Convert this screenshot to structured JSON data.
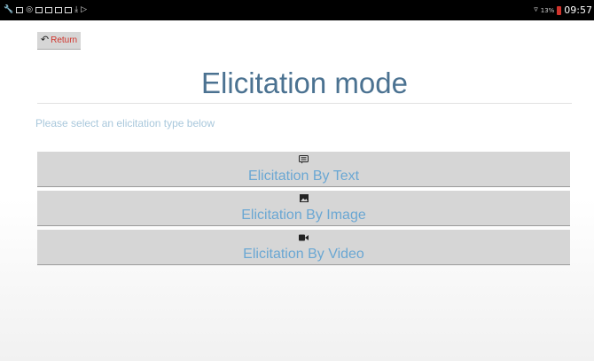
{
  "status_bar": {
    "battery_percent": "13%",
    "time": "09:57"
  },
  "return_button": {
    "label": "Return"
  },
  "page": {
    "title": "Elicitation mode",
    "subtitle": "Please select an elicitation type below"
  },
  "modes": [
    {
      "label": "Elicitation By Text",
      "icon": "text-message-icon"
    },
    {
      "label": "Elicitation By Image",
      "icon": "image-icon"
    },
    {
      "label": "Elicitation By Video",
      "icon": "video-camera-icon"
    }
  ],
  "colors": {
    "title": "#4b7291",
    "subtitle": "#a9c8dc",
    "button_text": "#6aa7d3",
    "button_bg": "#d6d6d6",
    "return_text": "#d0342c"
  }
}
